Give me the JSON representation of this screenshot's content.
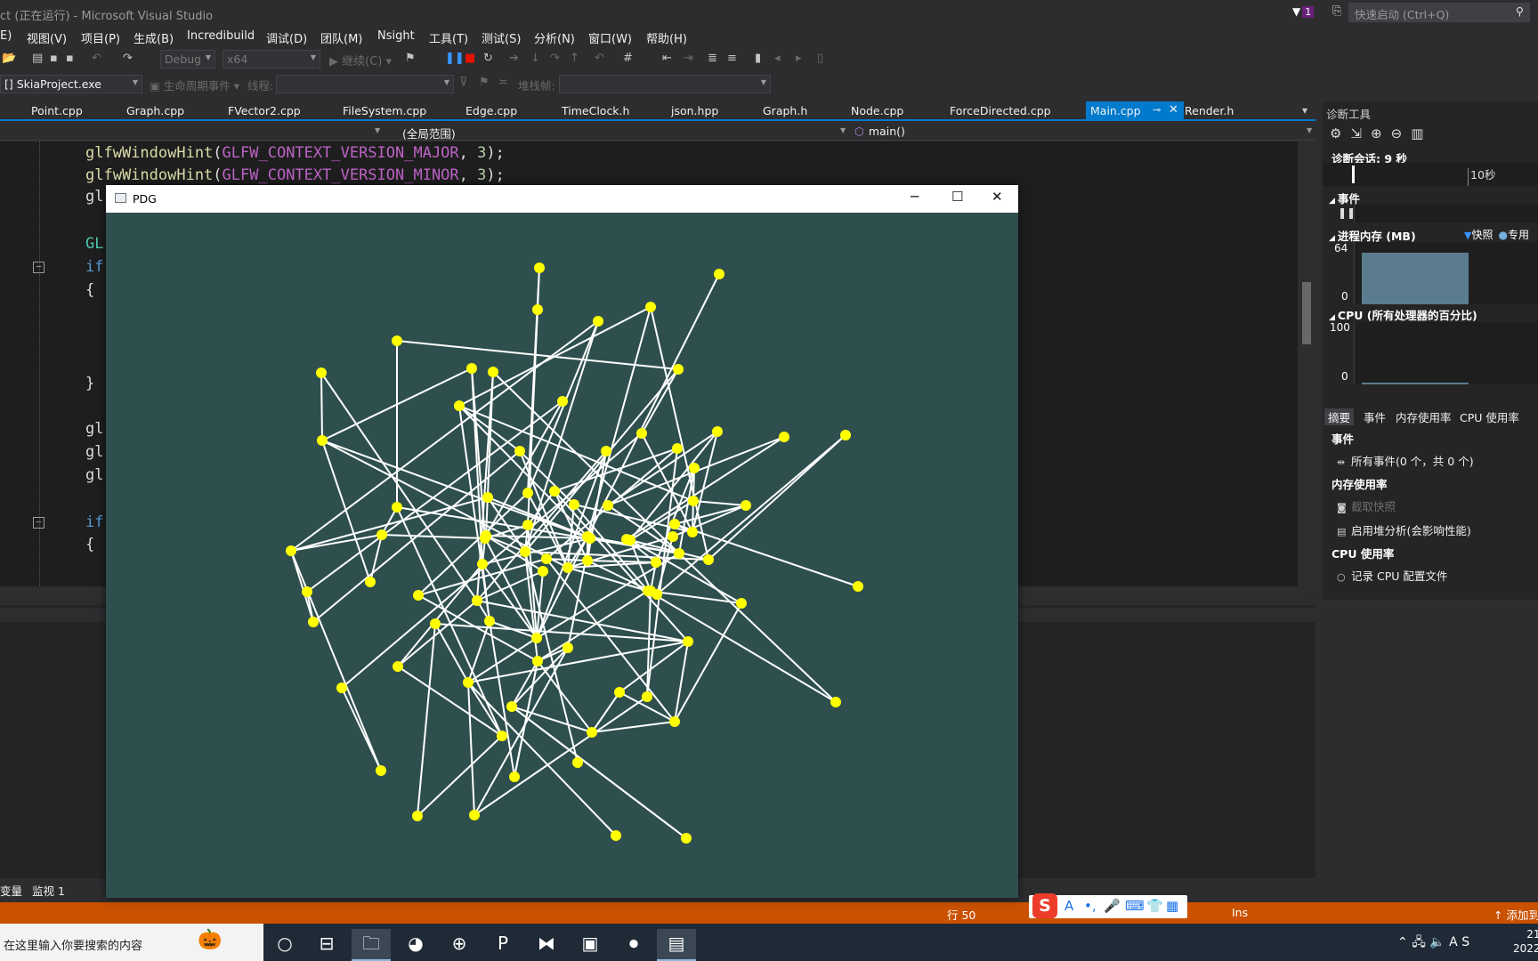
{
  "titlebar": {
    "title": "ct (正在运行) - Microsoft Visual Studio",
    "notification_count": "1",
    "quick_launch_placeholder": "快速启动 (Ctrl+Q)"
  },
  "menu": {
    "items": [
      "E)",
      "视图(V)",
      "项目(P)",
      "生成(B)",
      "Incredibuild",
      "调试(D)",
      "团队(M)",
      "Nsight",
      "工具(T)",
      "测试(S)",
      "分析(N)",
      "窗口(W)",
      "帮助(H)"
    ]
  },
  "toolbar": {
    "config": "Debug",
    "platform": "x64",
    "continue": "继续(C)",
    "process": "[] SkiaProject.exe",
    "lifecycle": "生命周期事件",
    "thread": "线程:",
    "stackframe": "堆栈帧:"
  },
  "tabs": [
    "Point.cpp",
    "Graph.cpp",
    "FVector2.cpp",
    "FileSystem.cpp",
    "Edge.cpp",
    "TimeClock.h",
    "json.hpp",
    "Graph.h",
    "Node.cpp",
    "ForceDirected.cpp",
    "Main.cpp",
    "Render.h"
  ],
  "active_tab": "Main.cpp",
  "navbar": {
    "scope": "(全局范围)",
    "function": "main()"
  },
  "code": {
    "line1_fn": "glfwWindowHint",
    "line1_macro": "GLFW_CONTEXT_VERSION_MAJOR",
    "line1_num": "3",
    "line2_fn": "glfwWindowHint",
    "line2_macro": "GLFW_CONTEXT_VERSION_MINOR",
    "line2_num": "3",
    "frag_gl": "gl",
    "frag_GL": "GL",
    "frag_if": "if",
    "brace_open": "{",
    "brace_close": "}",
    "open_paren": "(",
    "comma": ", ",
    "close": ");"
  },
  "bottom_tabs": [
    "变量",
    "监视 1"
  ],
  "status": {
    "line": "行 50",
    "mode": "Ins",
    "publish": "↑ 添加到"
  },
  "taskbar": {
    "search_placeholder": "在这里输入你要搜索的内容",
    "clock_time": "21",
    "clock_date": "2022"
  },
  "diagnostics": {
    "title": "诊断工具",
    "session": "诊断会话: 9 秒",
    "timeline_label": "10秒",
    "events_section": "事件",
    "memory_section": "进程内存 (MB)",
    "memory_legend_snapshot": "快照",
    "memory_legend_private": "专用",
    "memory_max": "64",
    "memory_min": "0",
    "memory_level": 0.93,
    "cpu_section": "CPU (所有处理器的百分比)",
    "cpu_max": "100",
    "cpu_min": "0",
    "cpu_level": 0.04,
    "tabs": [
      "摘要",
      "事件",
      "内存使用率",
      "CPU 使用率"
    ],
    "h_events": "事件",
    "all_events": "所有事件(0 个，共 0 个)",
    "h_memory": "内存使用率",
    "take_snapshot": "截取快照",
    "heap_profile": "启用堆分析(会影响性能)",
    "h_cpu": "CPU 使用率",
    "record_cpu": "记录 CPU 配置文件"
  },
  "pdg_window": {
    "title": "PDG",
    "background": "#2f4f4f",
    "node_color": "#ffff00",
    "edge_color": "#ffffff"
  },
  "colors": {
    "accent": "#007acc",
    "status_bar": "#ca5100",
    "editor_bg": "#1e1e1e"
  }
}
